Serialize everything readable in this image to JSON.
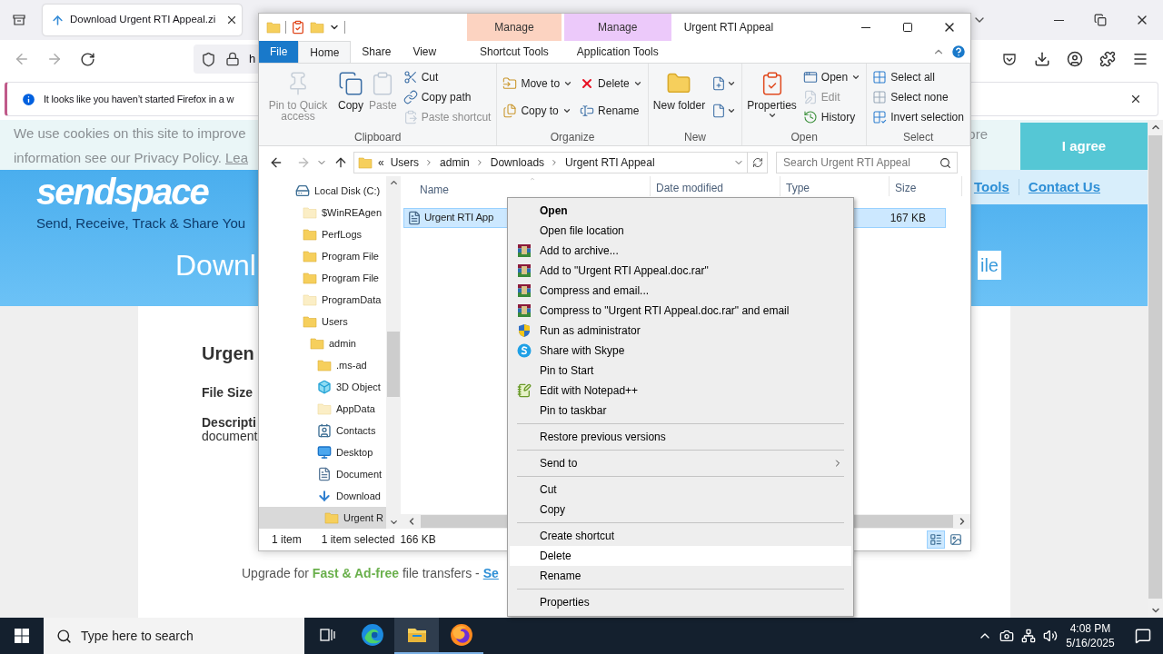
{
  "browser": {
    "tab": {
      "title": "Download Urgent RTI Appeal.zi"
    },
    "address": {
      "value": "h"
    },
    "notification": {
      "text": "It looks like you haven’t started Firefox in a w"
    },
    "page": {
      "cookie_lines": [
        "We use cookies on this site to improve",
        "information see our Privacy Policy."
      ],
      "cookie_link": "Lea",
      "cookie_tail": "ore",
      "agree_button": "I agree",
      "logo": "sendspace",
      "tagline": "Send, Receive, Track & Share You",
      "nav_links": [
        "Tools",
        "Contact Us"
      ],
      "heading": "Downl",
      "file_button": "ile",
      "file_title": "Urgen",
      "file_size_label": "File Size",
      "description_label": "Descripti",
      "description": "document",
      "upgrade_text": "Upgrade for **Fast & Ad-free** file transfers - ",
      "upgrade_link": "Se"
    }
  },
  "explorer": {
    "title": "Urgent RTI Appeal",
    "ribbon_tabs": [
      {
        "label": "File",
        "kind": "file",
        "selected": false
      },
      {
        "label": "Home",
        "kind": "normal",
        "selected": true
      },
      {
        "label": "Share",
        "kind": "normal",
        "selected": false
      },
      {
        "label": "View",
        "kind": "normal",
        "selected": false
      },
      {
        "label": "Shortcut Tools",
        "kind": "contextual",
        "group": "Manage",
        "color": "#fcd3c1",
        "selected": false
      },
      {
        "label": "Application Tools",
        "kind": "contextual",
        "group": "Manage",
        "color": "#ecc9fa",
        "selected": false
      }
    ],
    "groups": [
      {
        "name": "Clipboard",
        "columns": [
          [
            {
              "label": "Pin to Quick access",
              "kind": "large",
              "disabled": true,
              "dropdown": false
            }
          ],
          [
            {
              "label": "Copy",
              "kind": "large",
              "disabled": false,
              "dropdown": false
            }
          ],
          [
            {
              "label": "Paste",
              "kind": "large",
              "disabled": true,
              "dropdown": false
            }
          ],
          [
            {
              "label": "Cut",
              "kind": "small",
              "disabled": false,
              "dropdown": false
            },
            {
              "label": "Copy path",
              "kind": "small",
              "disabled": false,
              "dropdown": false
            },
            {
              "label": "Paste shortcut",
              "kind": "small",
              "disabled": true,
              "dropdown": false
            }
          ]
        ]
      },
      {
        "name": "Organize",
        "columns": [
          [
            {
              "label": "Move to",
              "kind": "small",
              "disabled": false,
              "dropdown": true
            },
            {
              "label": "Copy to",
              "kind": "small",
              "disabled": false,
              "dropdown": true
            }
          ],
          [
            {
              "label": "Delete",
              "kind": "small",
              "disabled": false,
              "dropdown": true
            },
            {
              "label": "Rename",
              "kind": "small",
              "disabled": false,
              "dropdown": false
            }
          ]
        ]
      },
      {
        "name": "New",
        "columns": [
          [
            {
              "label": "New folder",
              "kind": "large",
              "disabled": false,
              "dropdown": false
            }
          ],
          [
            {
              "kind": "icon",
              "disabled": false,
              "dropdown": true
            },
            {
              "kind": "icon",
              "disabled": false,
              "dropdown": true
            }
          ]
        ]
      },
      {
        "name": "Open",
        "columns": [
          [
            {
              "label": "Properties",
              "kind": "large",
              "disabled": false,
              "dropdown": true
            }
          ],
          [
            {
              "label": "Open",
              "kind": "small",
              "disabled": false,
              "dropdown": true
            },
            {
              "label": "Edit",
              "kind": "small",
              "disabled": true,
              "dropdown": false
            },
            {
              "label": "History",
              "kind": "small",
              "disabled": false,
              "dropdown": false
            }
          ]
        ]
      },
      {
        "name": "Select",
        "columns": [
          [
            {
              "label": "Select all",
              "kind": "small",
              "disabled": false,
              "dropdown": false
            },
            {
              "label": "Select none",
              "kind": "small",
              "disabled": false,
              "dropdown": false
            },
            {
              "label": "Invert selection",
              "kind": "small",
              "disabled": false,
              "dropdown": false
            }
          ]
        ]
      }
    ],
    "address": {
      "overflow_marker": "«",
      "breadcrumbs": [
        "Users",
        "admin",
        "Downloads",
        "Urgent RTI Appeal"
      ]
    },
    "search": {
      "placeholder": "Search Urgent RTI Appeal"
    },
    "tree": [
      {
        "label": "Local Disk (C:)",
        "kind": "drive",
        "selected": false,
        "children": [
          {
            "label": "$WinREAgen",
            "kind": "folder_faded",
            "selected": false
          },
          {
            "label": "PerfLogs",
            "kind": "folder",
            "selected": false
          },
          {
            "label": "Program File",
            "kind": "folder",
            "selected": false
          },
          {
            "label": "Program File",
            "kind": "folder",
            "selected": false
          },
          {
            "label": "ProgramData",
            "kind": "folder_faded",
            "selected": false
          },
          {
            "label": "Users",
            "kind": "folder",
            "selected": false,
            "children": [
              {
                "label": "admin",
                "kind": "folder",
                "selected": false,
                "children": [
                  {
                    "label": ".ms-ad",
                    "kind": "folder",
                    "selected": false
                  },
                  {
                    "label": "3D Object",
                    "kind": "cube",
                    "selected": false
                  },
                  {
                    "label": "AppData",
                    "kind": "folder_faded",
                    "selected": false
                  },
                  {
                    "label": "Contacts",
                    "kind": "contacts",
                    "selected": false
                  },
                  {
                    "label": "Desktop",
                    "kind": "desktop",
                    "selected": false
                  },
                  {
                    "label": "Document",
                    "kind": "document",
                    "selected": false
                  },
                  {
                    "label": "Download",
                    "kind": "download",
                    "selected": false,
                    "children": [
                      {
                        "label": "Urgent R",
                        "kind": "folder",
                        "selected": true
                      }
                    ]
                  }
                ]
              }
            ]
          }
        ]
      }
    ],
    "columns": [
      {
        "label": "Name",
        "sorted": true
      },
      {
        "label": "Date modified",
        "sorted": false
      },
      {
        "label": "Type",
        "sorted": false
      },
      {
        "label": "Size",
        "sorted": false
      }
    ],
    "files": [
      {
        "name": "Urgent RTI App",
        "size": "167 KB",
        "selected": true
      }
    ],
    "status": {
      "count": "1 item",
      "selection": "1 item selected",
      "size": "166 KB"
    },
    "view_modes": [
      {
        "kind": "details",
        "selected": true
      },
      {
        "kind": "tiles",
        "selected": false
      }
    ]
  },
  "context_menu": {
    "sections": [
      [
        {
          "label": "Open",
          "kind": "default",
          "selected": false
        },
        {
          "label": "Open file location",
          "kind": "plain",
          "selected": false
        },
        {
          "label": "Add to archive...",
          "kind": "archive",
          "selected": false
        },
        {
          "label": "Add to \"Urgent RTI Appeal.doc.rar\"",
          "kind": "archive",
          "selected": false
        },
        {
          "label": "Compress and email...",
          "kind": "archive",
          "selected": false
        },
        {
          "label": "Compress to \"Urgent RTI Appeal.doc.rar\" and email",
          "kind": "archive",
          "selected": false
        },
        {
          "label": "Run as administrator",
          "kind": "admin",
          "selected": false
        },
        {
          "label": "Share with Skype",
          "kind": "skype",
          "selected": false
        },
        {
          "label": "Pin to Start",
          "kind": "plain",
          "selected": false
        },
        {
          "label": "Edit with Notepad++",
          "kind": "notepad",
          "selected": false
        },
        {
          "label": "Pin to taskbar",
          "kind": "plain",
          "selected": false
        }
      ],
      [
        {
          "label": "Restore previous versions",
          "kind": "plain",
          "selected": false
        }
      ],
      [
        {
          "label": "Send to",
          "kind": "submenu",
          "selected": false
        }
      ],
      [
        {
          "label": "Cut",
          "kind": "plain",
          "selected": false
        },
        {
          "label": "Copy",
          "kind": "plain",
          "selected": false
        }
      ],
      [
        {
          "label": "Create shortcut",
          "kind": "plain",
          "selected": false
        },
        {
          "label": "Delete",
          "kind": "plain",
          "selected": true
        },
        {
          "label": "Rename",
          "kind": "plain",
          "selected": false
        }
      ],
      [
        {
          "label": "Properties",
          "kind": "plain",
          "selected": false
        }
      ]
    ]
  },
  "taskbar": {
    "search_placeholder": "Type here to search",
    "apps": [
      {
        "kind": "task_view",
        "active": false,
        "running": false
      },
      {
        "kind": "edge",
        "active": false,
        "running": false
      },
      {
        "kind": "explorer",
        "active": true,
        "running": true
      },
      {
        "kind": "firefox",
        "active": false,
        "running": true
      }
    ],
    "time": "4:08 PM",
    "date": "5/16/2025"
  }
}
